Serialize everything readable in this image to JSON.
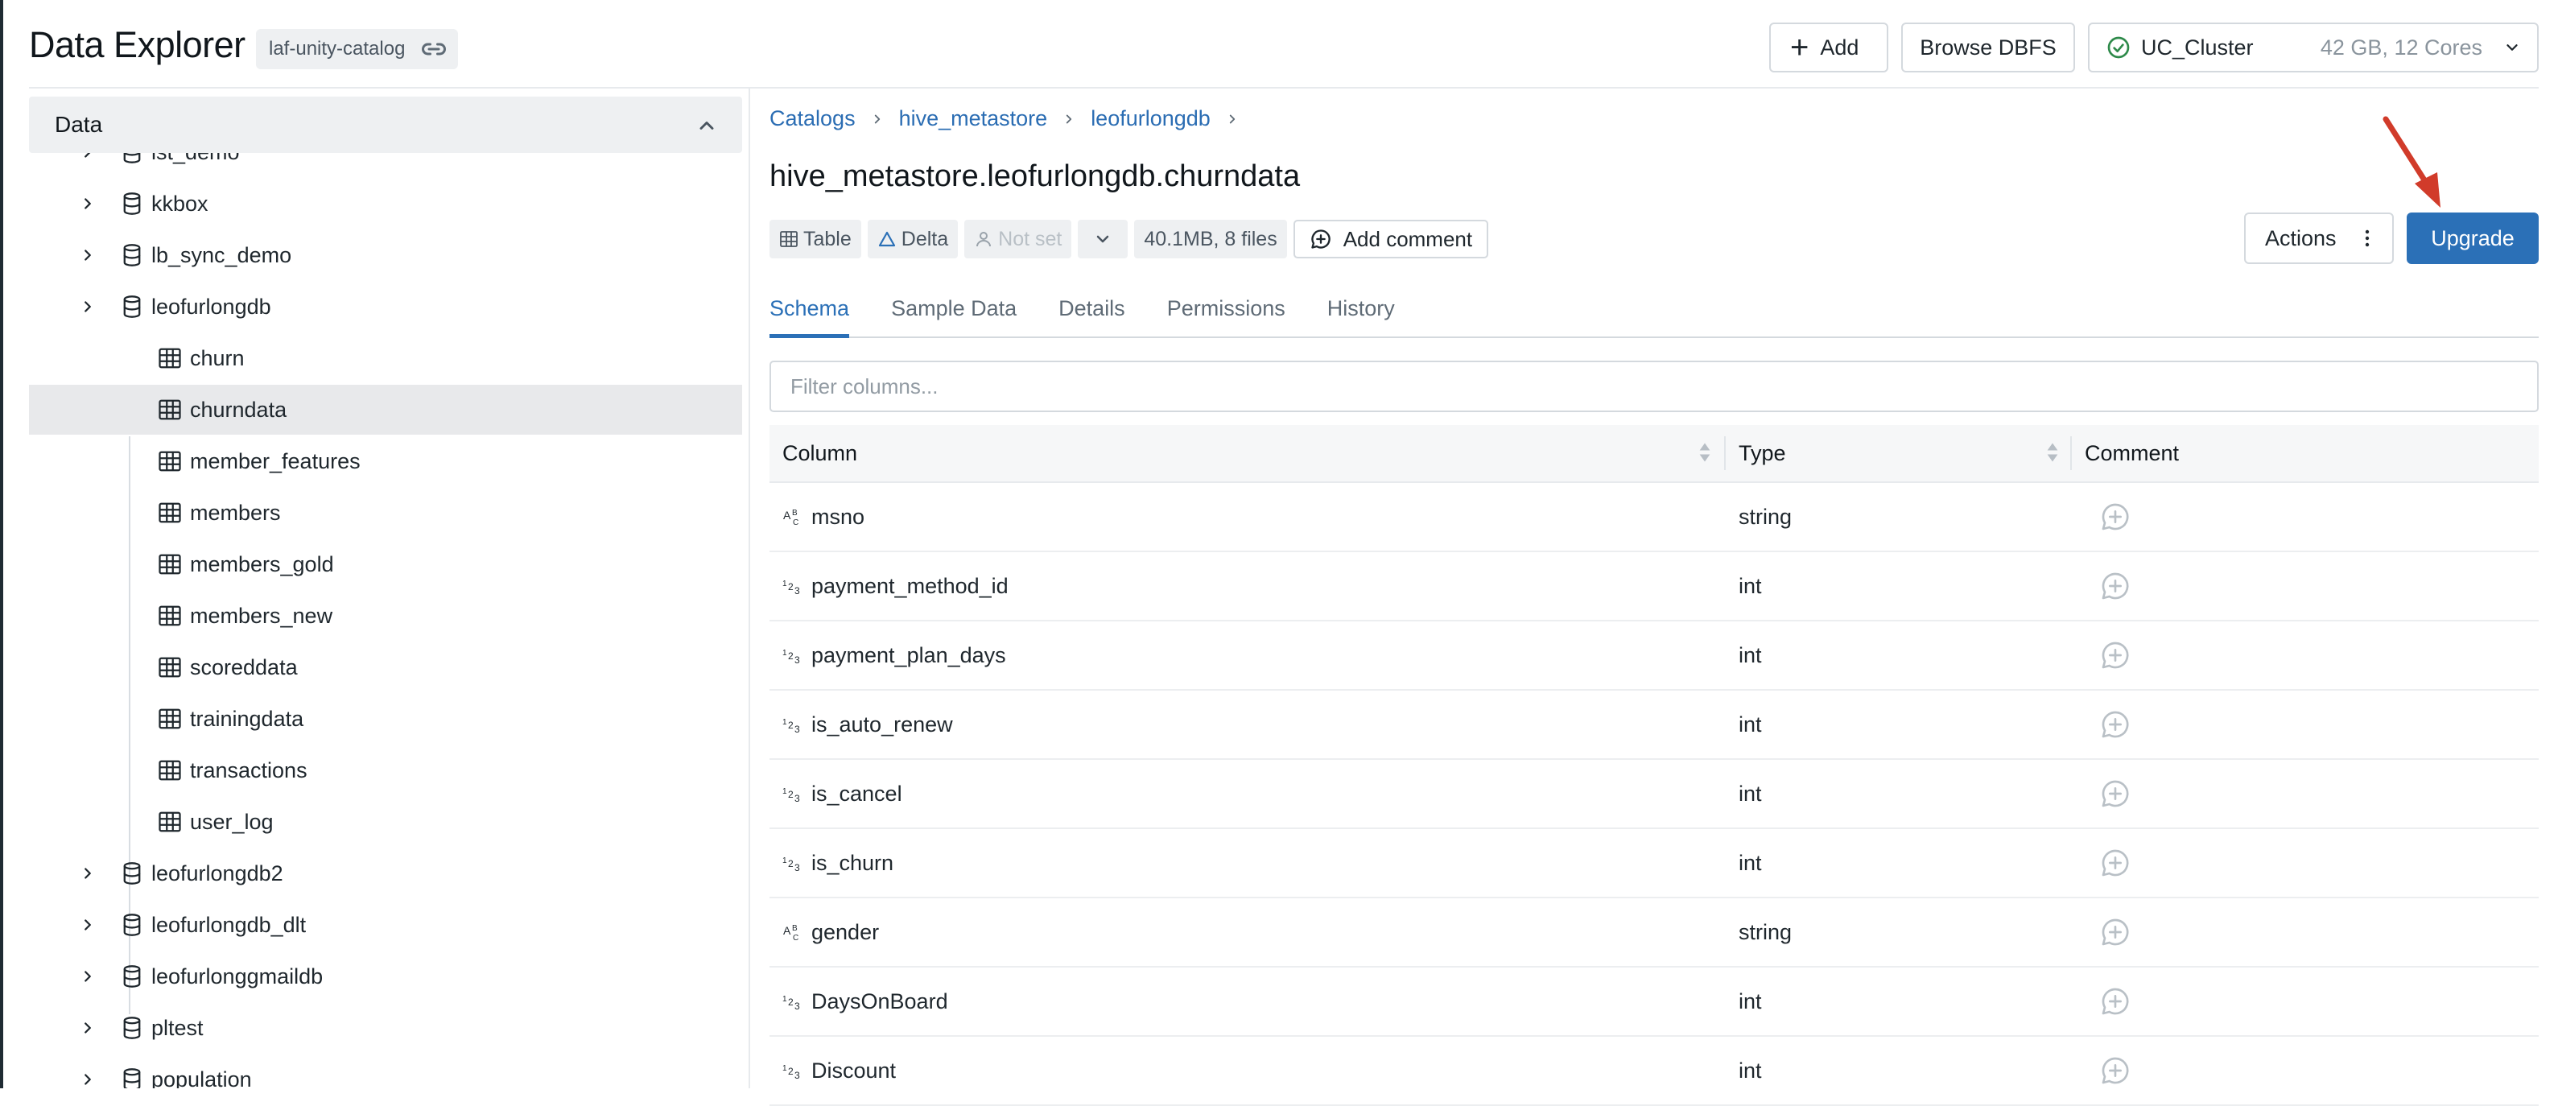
{
  "header": {
    "title": "Data Explorer",
    "catalog_badge": "laf-unity-catalog",
    "add_label": "Add",
    "browse_label": "Browse DBFS",
    "cluster_name": "UC_Cluster",
    "cluster_spec": "42 GB, 12 Cores"
  },
  "sidebar": {
    "title": "Data",
    "databases_before": [
      {
        "label": "lst_demo"
      },
      {
        "label": "kkbox"
      },
      {
        "label": "lb_sync_demo"
      }
    ],
    "expanded_db": "leofurlongdb",
    "tables": [
      {
        "label": "churn"
      },
      {
        "label": "churndata"
      },
      {
        "label": "member_features"
      },
      {
        "label": "members"
      },
      {
        "label": "members_gold"
      },
      {
        "label": "members_new"
      },
      {
        "label": "scoreddata"
      },
      {
        "label": "trainingdata"
      },
      {
        "label": "transactions"
      },
      {
        "label": "user_log"
      }
    ],
    "selected_table": "churndata",
    "databases_after": [
      {
        "label": "leofurlongdb2"
      },
      {
        "label": "leofurlongdb_dlt"
      },
      {
        "label": "leofurlonggmaildb"
      },
      {
        "label": "pltest"
      },
      {
        "label": "population"
      }
    ]
  },
  "main": {
    "breadcrumb": [
      "Catalogs",
      "hive_metastore",
      "leofurlongdb"
    ],
    "table_title": "hive_metastore.leofurlongdb.churndata",
    "chips": {
      "type": "Table",
      "format": "Delta",
      "owner": "Not set",
      "size": "40.1MB, 8 files"
    },
    "add_comment_label": "Add comment",
    "actions_label": "Actions",
    "upgrade_label": "Upgrade",
    "tabs": [
      {
        "label": "Schema",
        "active": true
      },
      {
        "label": "Sample Data",
        "active": false
      },
      {
        "label": "Details",
        "active": false
      },
      {
        "label": "Permissions",
        "active": false
      },
      {
        "label": "History",
        "active": false
      }
    ],
    "filter_placeholder": "Filter columns...",
    "columns_header": {
      "column": "Column",
      "type": "Type",
      "comment": "Comment"
    },
    "rows": [
      {
        "name": "msno",
        "type": "string",
        "icon": "string-type-icon"
      },
      {
        "name": "payment_method_id",
        "type": "int",
        "icon": "int-type-icon"
      },
      {
        "name": "payment_plan_days",
        "type": "int",
        "icon": "int-type-icon"
      },
      {
        "name": "is_auto_renew",
        "type": "int",
        "icon": "int-type-icon"
      },
      {
        "name": "is_cancel",
        "type": "int",
        "icon": "int-type-icon"
      },
      {
        "name": "is_churn",
        "type": "int",
        "icon": "int-type-icon"
      },
      {
        "name": "gender",
        "type": "string",
        "icon": "string-type-icon"
      },
      {
        "name": "DaysOnBoard",
        "type": "int",
        "icon": "int-type-icon"
      },
      {
        "name": "Discount",
        "type": "int",
        "icon": "int-type-icon"
      }
    ]
  },
  "colors": {
    "accent": "#2b70b7",
    "link": "#2b6db3",
    "annotation_arrow": "#d13b2a",
    "selected_row": "#e8e9eb"
  }
}
